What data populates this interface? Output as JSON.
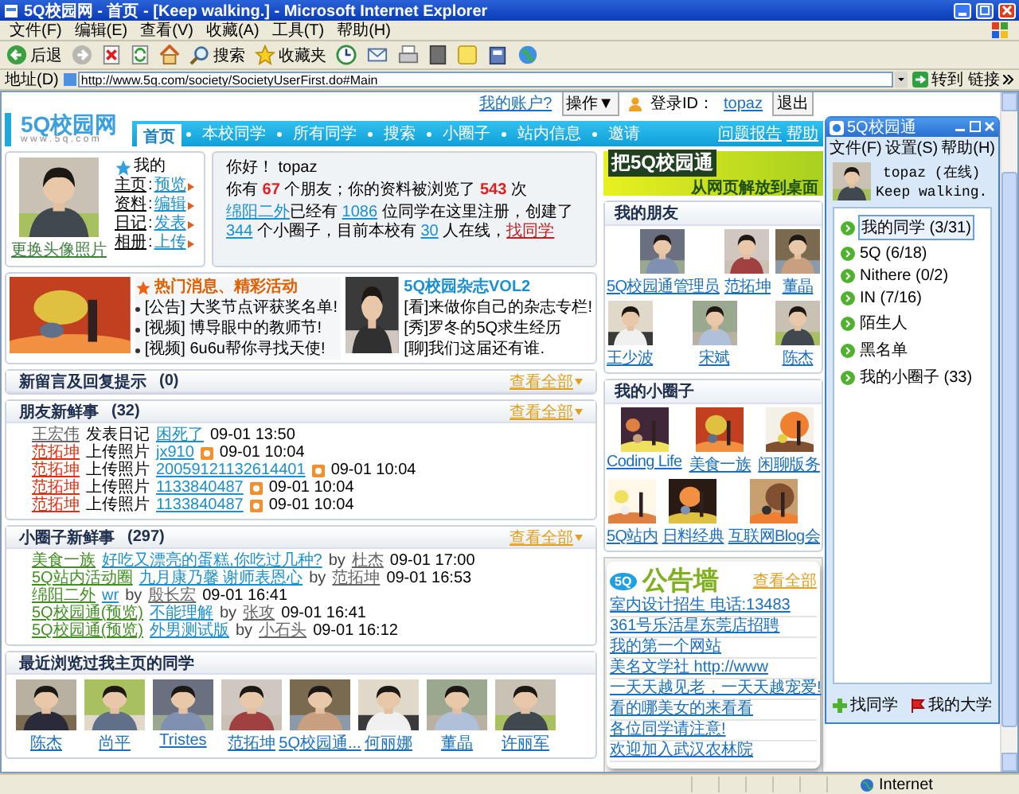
{
  "window": {
    "title": "5Q校园网 - 首页 - [Keep walking.] - Microsoft Internet Explorer"
  },
  "menu": [
    "文件(F)",
    "编辑(E)",
    "查看(V)",
    "收藏(A)",
    "工具(T)",
    "帮助(H)"
  ],
  "toolbar": [
    {
      "kind": "back",
      "label": "后退"
    },
    {
      "kind": "forward"
    },
    {
      "kind": "stop"
    },
    {
      "kind": "refresh"
    },
    {
      "kind": "home"
    },
    {
      "kind": "search",
      "label": "搜索"
    },
    {
      "kind": "favorites",
      "label": "收藏夹"
    },
    {
      "kind": "history"
    },
    {
      "kind": "mail"
    },
    {
      "kind": "print"
    },
    {
      "kind": "edit"
    },
    {
      "kind": "note"
    },
    {
      "kind": "book"
    },
    {
      "kind": "globe"
    }
  ],
  "address": {
    "label": "地址(D)",
    "url": "http://www.5q.com/society/SocietyUserFirst.do#Main",
    "go": "转到",
    "links": "链接"
  },
  "top_links": {
    "account": "我的账户?",
    "operate": "操作▼",
    "login_label": "登录ID：",
    "login_id": "topaz",
    "logout": "退出"
  },
  "logo": {
    "name": "5Q校园网",
    "url": "w w w . 5 q . c o m"
  },
  "nav": {
    "tabs": [
      {
        "label": "首页",
        "selected": true
      },
      {
        "label": "本校同学",
        "selected": false
      },
      {
        "label": "所有同学",
        "selected": false
      },
      {
        "label": "搜索",
        "selected": false
      },
      {
        "label": "小圈子",
        "selected": false
      },
      {
        "label": "站内信息",
        "selected": false
      },
      {
        "label": "邀请",
        "selected": false
      }
    ],
    "links": [
      "问题报告",
      "帮助"
    ]
  },
  "profile": {
    "heading": "我的",
    "separator": ":",
    "links": [
      {
        "label": "主页",
        "action": "预览"
      },
      {
        "label": "资料",
        "action": "编辑"
      },
      {
        "label": "日记",
        "action": "发表"
      },
      {
        "label": "相册",
        "action": "上传"
      }
    ],
    "change_photo": "更换头像照片"
  },
  "greeting": {
    "hello": "你好！ topaz",
    "lines": [
      {
        "parts": [
          {
            "text": "你有 ",
            "kind": "plain"
          },
          {
            "text": "67",
            "kind": "count"
          },
          {
            "text": " 个朋友；你的资料被浏览了 ",
            "kind": "plain"
          },
          {
            "text": "543",
            "kind": "count"
          },
          {
            "text": " 次",
            "kind": "plain"
          }
        ]
      },
      {
        "parts": [
          {
            "text": "绵阳二外",
            "kind": "link"
          },
          {
            "text": "已经有 ",
            "kind": "plain"
          },
          {
            "text": "1086",
            "kind": "link"
          },
          {
            "text": " 位同学在这里注册，创建了 ",
            "kind": "plain"
          },
          {
            "text": "344",
            "kind": "link"
          },
          {
            "text": " 个小圈子，目前本校有 ",
            "kind": "plain"
          },
          {
            "text": "30",
            "kind": "link"
          },
          {
            "text": " 人在线，",
            "kind": "plain"
          },
          {
            "text": "找同学",
            "kind": "action"
          }
        ]
      }
    ]
  },
  "news": {
    "title": "热门消息、精彩活动",
    "items": [
      "[公告] 大奖节点评获奖名单!",
      "[视频] 博导眼中的教师节!",
      "[视频] 6u6u帮你寻找天使!"
    ]
  },
  "magazine": {
    "title": "5Q校园杂志VOL2",
    "items": [
      "[看]来做你自己的杂志专栏!",
      "[秀]罗冬的5Q求生经历",
      "[聊]我们这届还有谁."
    ]
  },
  "messages": {
    "title": "新留言及回复提示",
    "count": "(0)",
    "more": "查看全部"
  },
  "friend_news": {
    "title": "朋友新鲜事",
    "count": "(32)",
    "more": "查看全部",
    "items": [
      {
        "who": "王宏伟",
        "highlight": false,
        "action": "发表日记",
        "target": "困死了",
        "photo": false,
        "time": "09-01 13:50"
      },
      {
        "who": "范拓坤",
        "highlight": true,
        "action": "上传照片",
        "target": "jx910",
        "photo": true,
        "time": "09-01 10:04"
      },
      {
        "who": "范拓坤",
        "highlight": true,
        "action": "上传照片",
        "target": "20059121132614401",
        "photo": true,
        "time": "09-01 10:04"
      },
      {
        "who": "范拓坤",
        "highlight": true,
        "action": "上传照片",
        "target": "1133840487",
        "photo": true,
        "time": "09-01 10:04"
      },
      {
        "who": "范拓坤",
        "highlight": true,
        "action": "上传照片",
        "target": "1133840487",
        "photo": true,
        "time": "09-01 10:04"
      }
    ]
  },
  "circle_news": {
    "title": "小圈子新鲜事",
    "count": "(297)",
    "more": "查看全部",
    "items": [
      {
        "circle": "美食一族",
        "topic": "好吃又漂亮的蛋糕,你吃过几种?",
        "by": "by",
        "author": "杜杰",
        "time": "09-01 17:00"
      },
      {
        "circle": "5Q站内活动圈",
        "topic": "九月康乃馨 谢师表恩心",
        "by": "by",
        "author": "范拓坤",
        "time": "09-01 16:53"
      },
      {
        "circle": "绵阳二外",
        "topic": "wr",
        "by": "by",
        "author": "殷长宏",
        "time": "09-01 16:41"
      },
      {
        "circle": "5Q校园通(预览)",
        "topic": "不能理解",
        "by": "by",
        "author": "张攻",
        "time": "09-01 16:41"
      },
      {
        "circle": "5Q校园通(预览)",
        "topic": "外男测试版",
        "by": "by",
        "author": "小石头",
        "time": "09-01 16:12"
      }
    ]
  },
  "visitors": {
    "title": "最近浏览过我主页的同学",
    "people": [
      "陈杰",
      "尚平",
      "Tristes",
      "范拓坤",
      "5Q校园通...",
      "何丽娜",
      "董晶",
      "许丽军"
    ]
  },
  "ad": {
    "title": "把5Q校园通",
    "subtitle": "从网页解放到桌面"
  },
  "friends": {
    "title": "我的朋友",
    "people": [
      "5Q校园通管理员",
      "范拓坤",
      "董晶",
      "王少波",
      "宋斌",
      "陈杰"
    ]
  },
  "circles": {
    "title": "我的小圈子",
    "items": [
      "Coding Life",
      "美食一族",
      "闲聊版务",
      "5Q站内",
      "日料经典",
      "互联网Blog会"
    ]
  },
  "notice": {
    "badge": "5Q",
    "title": "公告墙",
    "more": "查看全部",
    "items": [
      "室内设计招生 电话:13483",
      "361号乐活星东莞店招聘",
      "我的第一个网站",
      "美名文学社 http://www",
      "一天天越见老，一天天越宠爱!",
      "看的哪美女的来看看",
      "各位同学请注意!",
      "欢迎加入武汉农林院"
    ]
  },
  "im": {
    "title": "5Q校园通",
    "menu": [
      "文件(F)",
      "设置(S)",
      "帮助(H)"
    ],
    "status": "topaz (在线)",
    "mood": "Keep walking.",
    "groups": [
      {
        "label": "我的同学 (3/31)",
        "selected": true
      },
      {
        "label": "5Q (6/18)",
        "selected": false
      },
      {
        "label": "Nithere (0/2)",
        "selected": false
      },
      {
        "label": "IN (7/16)",
        "selected": false
      },
      {
        "label": "陌生人",
        "selected": false
      },
      {
        "label": "黑名单",
        "selected": false
      },
      {
        "label": "我的小圈子 (33)",
        "selected": false
      }
    ],
    "buttons": [
      "找同学",
      "我的大学"
    ]
  },
  "status_bar": {
    "zone": "Internet"
  }
}
